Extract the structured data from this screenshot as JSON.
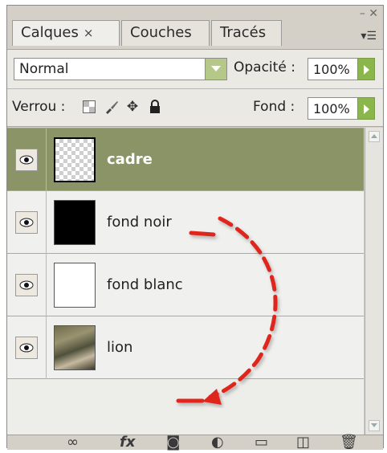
{
  "tabs": [
    {
      "label": "Calques",
      "close": "×",
      "active": true
    },
    {
      "label": "Couches",
      "active": false
    },
    {
      "label": "Tracés",
      "active": false
    }
  ],
  "blend": {
    "mode": "Normal",
    "opacity_label": "Opacité :",
    "opacity_value": "100%"
  },
  "lock": {
    "label": "Verrou :",
    "fill_label": "Fond :",
    "fill_value": "100%"
  },
  "layers": [
    {
      "name": "cadre",
      "selected": true,
      "thumb": "transparent-checker"
    },
    {
      "name": "fond noir",
      "selected": false,
      "thumb": "black"
    },
    {
      "name": "fond blanc",
      "selected": false,
      "thumb": "white"
    },
    {
      "name": "lion",
      "selected": false,
      "thumb": "photo-lion"
    }
  ],
  "icons": {
    "eye": "eye-icon",
    "bottom": [
      "link-layers-icon",
      "fx-icon",
      "mask-icon",
      "adjustment-icon",
      "folder-icon",
      "new-layer-icon",
      "trash-icon"
    ],
    "lock": [
      "lock-transparency-icon",
      "lock-brush-icon",
      "lock-move-icon",
      "lock-all-icon"
    ]
  },
  "fx_label": "fx",
  "colors": {
    "selected_row": "#8b9467",
    "accent_green": "#8bb64c",
    "annotation_red": "#e0251b"
  }
}
